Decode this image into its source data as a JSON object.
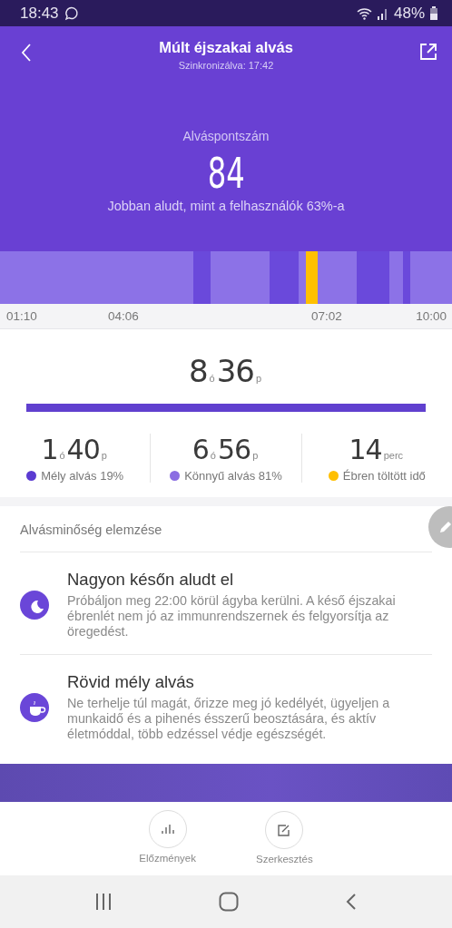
{
  "status_bar": {
    "time": "18:43",
    "battery": "48%"
  },
  "header": {
    "title": "Múlt éjszakai alvás",
    "subtitle": "Szinkronizálva: 17:42",
    "score_label": "Alváspontszám",
    "score": "84",
    "comparison": "Jobban aludt, mint a felhasználók 63%-a"
  },
  "stages": [
    {
      "kind": "light"
    },
    {
      "kind": "deep"
    },
    {
      "kind": "light"
    },
    {
      "kind": "deep"
    },
    {
      "kind": "light"
    },
    {
      "kind": "awake"
    },
    {
      "kind": "light"
    },
    {
      "kind": "deep"
    },
    {
      "kind": "light"
    },
    {
      "kind": "deep"
    },
    {
      "kind": "light"
    }
  ],
  "time_axis": [
    "01:10",
    "04:06",
    "07:02",
    "10:00"
  ],
  "total": {
    "hours": "8",
    "hour_unit": "ó",
    "minutes": "36",
    "minute_unit": "p"
  },
  "breakdown": [
    {
      "value": "1",
      "unit": "ó",
      "value2": "40",
      "unit2": "p",
      "label": "Mély alvás 19%",
      "color": "#5b3bd1"
    },
    {
      "value": "6",
      "unit": "ó",
      "value2": "56",
      "unit2": "p",
      "label": "Könnyű alvás 81%",
      "color": "#8b6de2"
    },
    {
      "value": "14",
      "unit": "perc",
      "label": "Ébren töltött idő",
      "color": "#ffbf00"
    }
  ],
  "analysis": {
    "title": "Alvásminőség elemzése",
    "items": [
      {
        "kind": "moon",
        "title": "Nagyon későn aludt el",
        "text": "Próbáljon meg 22:00 körül ágyba kerülni. A késő éjszakai ébrenlét nem jó az immunrendszernek és felgyorsítja az öregedést."
      },
      {
        "kind": "cup",
        "title": "Rövid mély alvás",
        "text": "Ne terhelje túl magát, őrizze meg jó kedélyét, ügyeljen a munkaidő és a pihenés ésszerű beosztására, és aktív életmóddal, több edzéssel védje egészségét."
      }
    ]
  },
  "actions": [
    {
      "kind": "history",
      "label": "Előzmények"
    },
    {
      "kind": "edit",
      "label": "Szerkesztés"
    }
  ]
}
